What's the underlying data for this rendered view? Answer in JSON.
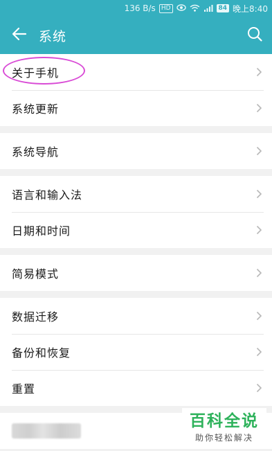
{
  "status_bar": {
    "net_speed": "136 B/s",
    "hd_badge": "HD",
    "battery": "84",
    "time": "晚上8:40",
    "icons": [
      "hd-icon",
      "eye-icon",
      "wifi-icon",
      "signal-icon",
      "battery-icon"
    ]
  },
  "app_bar": {
    "title": "系统",
    "back_icon": "back-arrow-icon",
    "search_icon": "search-icon"
  },
  "groups": [
    {
      "items": [
        {
          "label": "关于手机"
        },
        {
          "label": "系统更新"
        }
      ]
    },
    {
      "items": [
        {
          "label": "系统导航"
        }
      ]
    },
    {
      "items": [
        {
          "label": "语言和输入法"
        },
        {
          "label": "日期和时间"
        }
      ]
    },
    {
      "items": [
        {
          "label": "简易模式"
        }
      ]
    },
    {
      "items": [
        {
          "label": "数据迁移"
        },
        {
          "label": "备份和恢复"
        },
        {
          "label": "重置"
        }
      ]
    }
  ],
  "watermark": {
    "title": "百科全说",
    "subtitle": "助你轻松解决"
  },
  "colors": {
    "accent": "#35afbf",
    "highlight": "#d94bd6",
    "watermark": "#2eb25b"
  }
}
